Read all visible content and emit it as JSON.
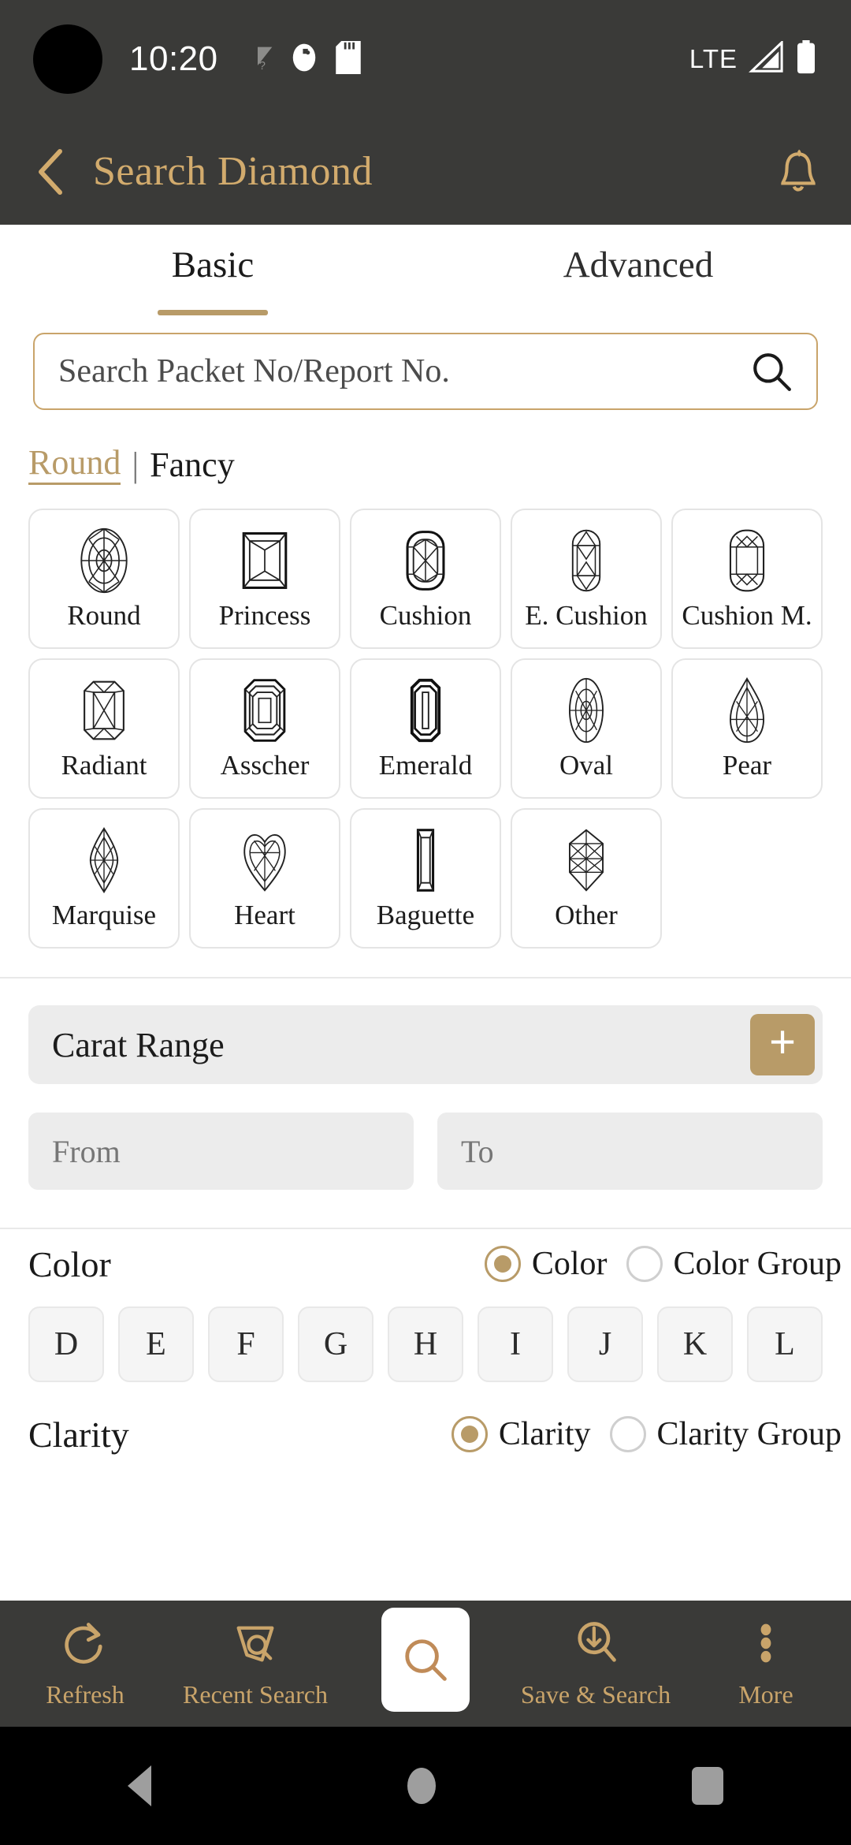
{
  "status_bar": {
    "time": "10:20",
    "network_label": "LTE",
    "icons": [
      "wifi-unknown-icon",
      "app-notification-icon",
      "sd-card-icon",
      "signal-icon",
      "battery-icon"
    ]
  },
  "app_bar": {
    "title": "Search Diamond",
    "back_icon": "chevron-left-icon",
    "notification_icon": "bell-icon"
  },
  "tabs": [
    {
      "label": "Basic",
      "active": true
    },
    {
      "label": "Advanced",
      "active": false
    }
  ],
  "search": {
    "placeholder": "Search Packet No/Report No.",
    "value": "",
    "icon": "search-icon"
  },
  "shape_filter": {
    "round_label": "Round",
    "separator": "|",
    "fancy_label": "Fancy",
    "active": "Round"
  },
  "shapes": [
    {
      "label": "Round",
      "icon": "diamond-round-icon"
    },
    {
      "label": "Princess",
      "icon": "diamond-princess-icon"
    },
    {
      "label": "Cushion",
      "icon": "diamond-cushion-icon"
    },
    {
      "label": "E. Cushion",
      "icon": "diamond-elongated-cushion-icon"
    },
    {
      "label": "Cushion M.",
      "icon": "diamond-cushion-modified-icon"
    },
    {
      "label": "Radiant",
      "icon": "diamond-radiant-icon"
    },
    {
      "label": "Asscher",
      "icon": "diamond-asscher-icon"
    },
    {
      "label": "Emerald",
      "icon": "diamond-emerald-icon"
    },
    {
      "label": "Oval",
      "icon": "diamond-oval-icon"
    },
    {
      "label": "Pear",
      "icon": "diamond-pear-icon"
    },
    {
      "label": "Marquise",
      "icon": "diamond-marquise-icon"
    },
    {
      "label": "Heart",
      "icon": "diamond-heart-icon"
    },
    {
      "label": "Baguette",
      "icon": "diamond-baguette-icon"
    },
    {
      "label": "Other",
      "icon": "diamond-other-icon"
    }
  ],
  "carat": {
    "title": "Carat Range",
    "add_icon": "plus-icon",
    "from_placeholder": "From",
    "from_value": "",
    "to_placeholder": "To",
    "to_value": ""
  },
  "color": {
    "title": "Color",
    "mode_options": [
      {
        "label": "Color",
        "selected": true
      },
      {
        "label": "Color Group",
        "selected": false
      }
    ],
    "chips": [
      "D",
      "E",
      "F",
      "G",
      "H",
      "I",
      "J",
      "K",
      "L"
    ]
  },
  "clarity": {
    "title": "Clarity",
    "mode_options": [
      {
        "label": "Clarity",
        "selected": true
      },
      {
        "label": "Clarity Group",
        "selected": false
      }
    ]
  },
  "bottom_nav": [
    {
      "label": "Refresh",
      "icon": "refresh-icon"
    },
    {
      "label": "Recent Search",
      "icon": "recent-search-icon"
    },
    {
      "label": "",
      "icon": "search-icon"
    },
    {
      "label": "Save & Search",
      "icon": "save-search-icon"
    },
    {
      "label": "More",
      "icon": "more-vertical-icon"
    }
  ],
  "android_nav": {
    "back": "back-triangle-icon",
    "home": "home-circle-icon",
    "recents": "recents-square-icon"
  },
  "colors": {
    "gold": "#b89b68",
    "gold_light": "#d2ab6d",
    "bar_dark": "#3a3a38",
    "chip_bg": "#f5f5f5",
    "field_bg": "#ececec"
  }
}
